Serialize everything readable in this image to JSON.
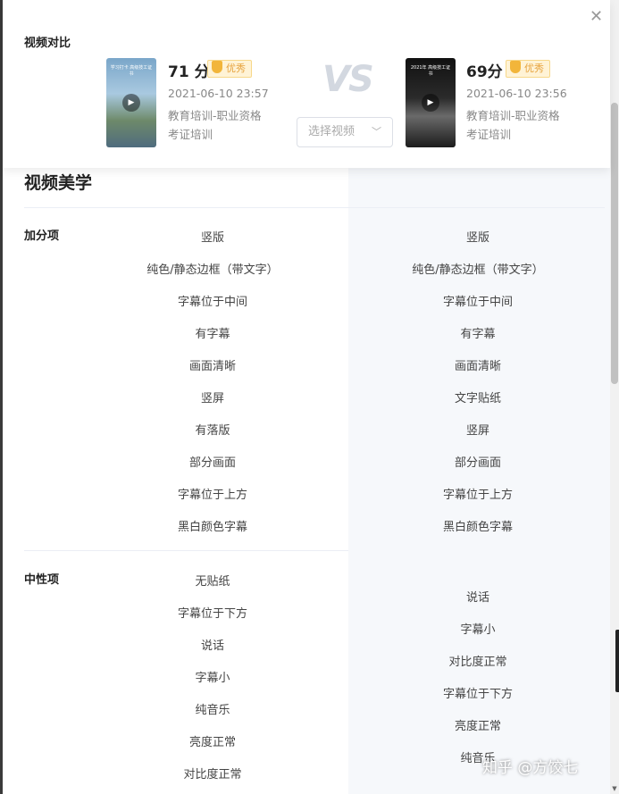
{
  "header": {
    "title": "视频对比",
    "vs_text": "VS",
    "select_placeholder": "选择视频",
    "video_a": {
      "score": "71 分",
      "badge": "优秀",
      "date": "2021-06-10 23:57",
      "category_line1": "教育培训-职业资格",
      "category_line2": "考证培训",
      "thumb_caption": "学习打卡 高级技工证书"
    },
    "video_b": {
      "score": "69分",
      "badge": "优秀",
      "date": "2021-06-10 23:56",
      "category_line1": "教育培训-职业资格",
      "category_line2": "考证培训",
      "thumb_caption": "2021年 高级技工证书"
    }
  },
  "section": {
    "title": "视频美学",
    "bonus_label": "加分项",
    "neutral_label": "中性项"
  },
  "bonus_left": [
    "竖版",
    "纯色/静态边框（带文字）",
    "字幕位于中间",
    "有字幕",
    "画面清晰",
    "竖屏",
    "有落版",
    "部分画面",
    "字幕位于上方",
    "黑白颜色字幕"
  ],
  "bonus_right": [
    "竖版",
    "纯色/静态边框（带文字）",
    "字幕位于中间",
    "有字幕",
    "画面清晰",
    "文字贴纸",
    "竖屏",
    "部分画面",
    "字幕位于上方",
    "黑白颜色字幕"
  ],
  "neutral_left": [
    "无贴纸",
    "字幕位于下方",
    "说话",
    "字幕小",
    "纯音乐",
    "亮度正常",
    "对比度正常"
  ],
  "neutral_right": [
    "说话",
    "字幕小",
    "对比度正常",
    "字幕位于下方",
    "亮度正常",
    "纯音乐"
  ],
  "watermark": "知乎 @方饺七",
  "colors": {
    "badge_bg": "#fff3d6",
    "badge_text": "#e6a23c",
    "vs": "#d3d8e0",
    "right_panel": "#f6f8fb"
  },
  "icons": {
    "close": "close-icon",
    "play": "play-icon",
    "chevron": "chevron-down-icon",
    "medal": "medal-icon"
  }
}
